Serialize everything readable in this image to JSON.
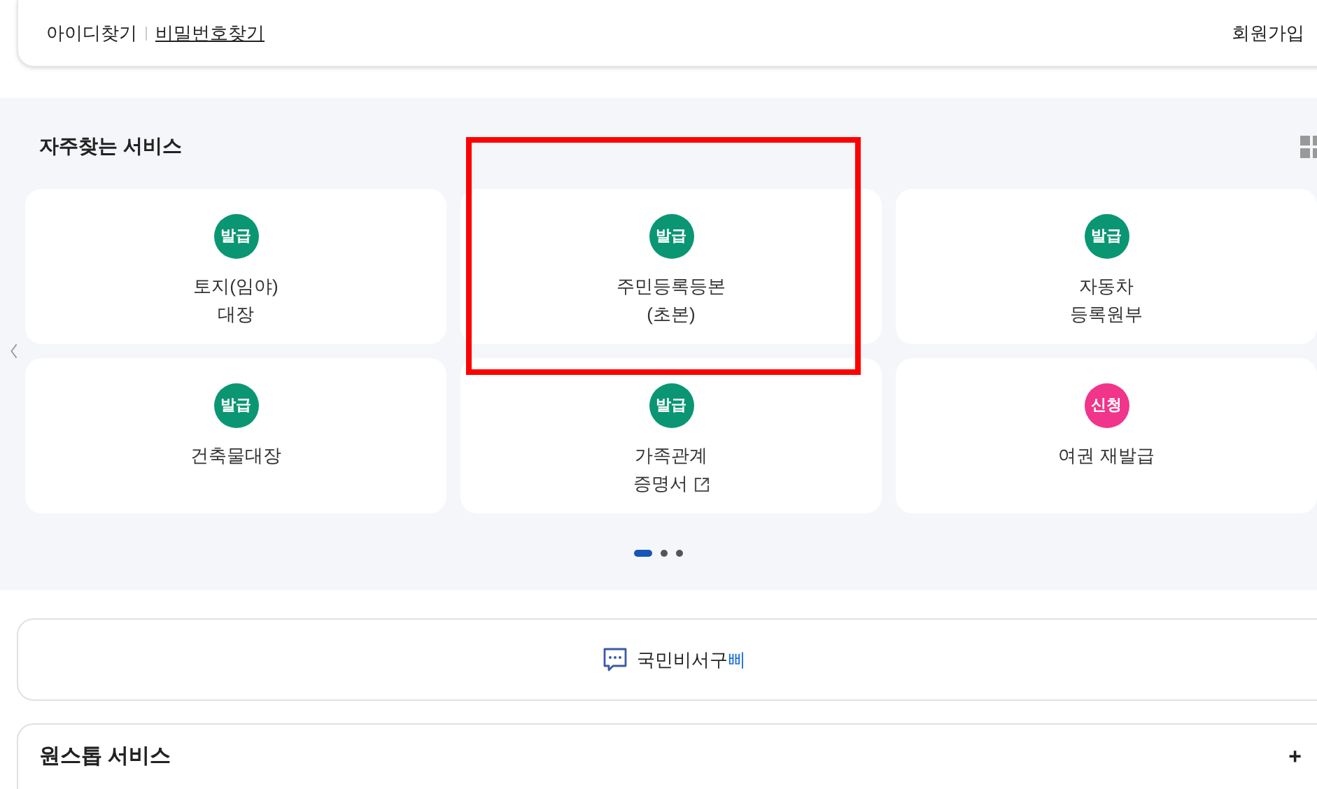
{
  "login_links": [
    {
      "label": "아이디찾기",
      "underlined": false
    },
    {
      "label": "비밀번호찾기",
      "underlined": true
    }
  ],
  "signup": "회원가입",
  "favorites": {
    "title": "자주찾는 서비스",
    "services": [
      {
        "badge": "발급",
        "color": "#0a9673",
        "lines": [
          "토지(임야)",
          "대장"
        ],
        "external": false
      },
      {
        "badge": "발급",
        "color": "#0a9673",
        "lines": [
          "주민등록등본",
          "(초본)"
        ],
        "external": false
      },
      {
        "badge": "발급",
        "color": "#0a9673",
        "lines": [
          "자동차",
          "등록원부"
        ],
        "external": false
      },
      {
        "badge": "발급",
        "color": "#0a9673",
        "lines": [
          "건축물대장"
        ],
        "external": false
      },
      {
        "badge": "발급",
        "color": "#0a9673",
        "lines": [
          "가족관계",
          "증명서"
        ],
        "external": true
      },
      {
        "badge": "신청",
        "color": "#f0358a",
        "lines": [
          "여권 재발급"
        ],
        "external": false
      }
    ],
    "pages": [
      {
        "selected": true
      },
      {
        "selected": false
      },
      {
        "selected": false
      }
    ]
  },
  "assistant": {
    "label": "국민비서구",
    "accent": "삐"
  },
  "onestop": {
    "title": "원스톱 서비스",
    "toggle": "+"
  }
}
